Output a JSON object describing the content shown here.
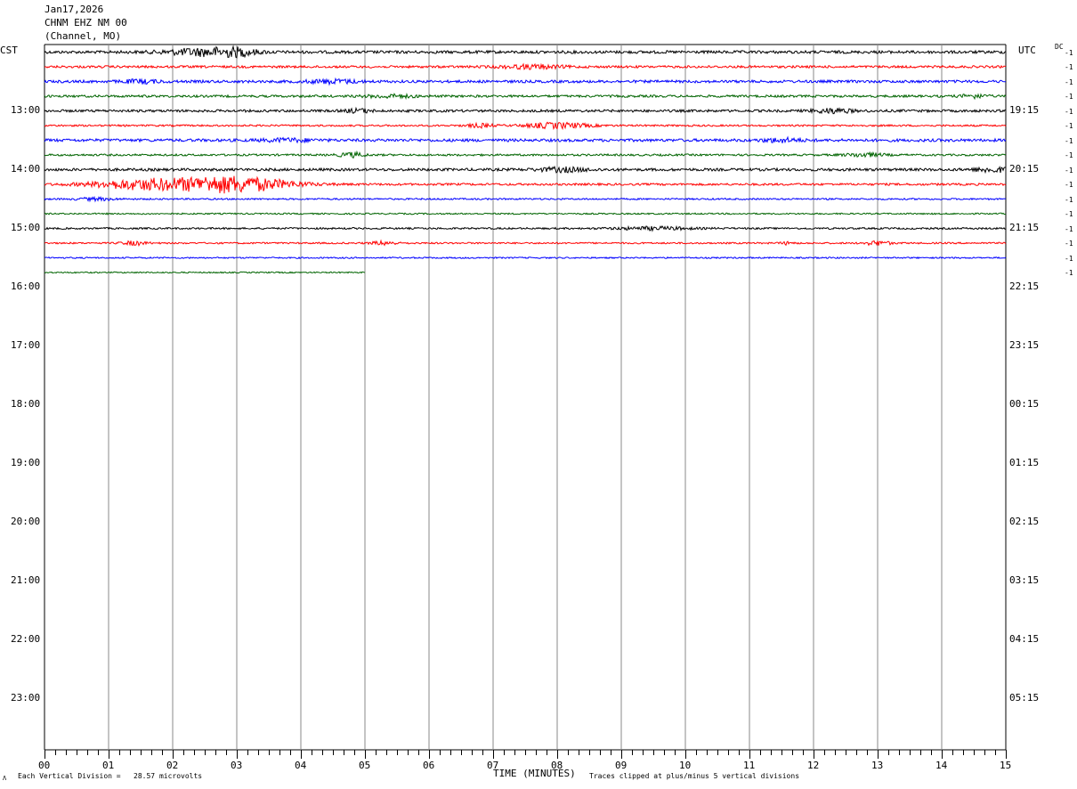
{
  "header": {
    "date": "Jan17,2026",
    "station": "CHNM EHZ NM 00",
    "location": "(Channel, MO)"
  },
  "axis": {
    "left_zone": "CST",
    "right_zone": "UTC",
    "dc_label": "DC",
    "xlabel": "TIME (MINUTES)"
  },
  "footer": {
    "division_note": "Each Vertical Division =   28.57 microvolts",
    "clip_note": "Traces clipped at plus/minus 5 vertical divisions",
    "logo_mark": "Λ"
  },
  "chart_data": {
    "type": "line",
    "title": "",
    "x_ticks": [
      "00",
      "01",
      "02",
      "03",
      "04",
      "05",
      "06",
      "07",
      "08",
      "09",
      "10",
      "11",
      "12",
      "13",
      "14",
      "15"
    ],
    "xlim": [
      0,
      15
    ],
    "rows_total": 48,
    "rows_per_hour": 4,
    "left_hour_labels": [
      "13:00",
      "14:00",
      "15:00",
      "16:00",
      "17:00",
      "18:00",
      "19:00",
      "20:00",
      "21:00",
      "22:00",
      "23:00"
    ],
    "right_hour_labels": [
      "19:15",
      "20:15",
      "21:15",
      "22:15",
      "23:15",
      "00:15",
      "01:15",
      "02:15",
      "03:15",
      "04:15",
      "05:15"
    ],
    "first_label_row": 4,
    "trace_colors": [
      "#000000",
      "#ff0000",
      "#0000ff",
      "#006400"
    ],
    "traces": [
      {
        "row": 0,
        "end_minute": 15,
        "noise": 1.6,
        "events": [
          {
            "t": 2.5,
            "amp": 4,
            "w": 0.6
          },
          {
            "t": 3.0,
            "amp": 3,
            "w": 0.3
          }
        ]
      },
      {
        "row": 1,
        "end_minute": 15,
        "noise": 1.3,
        "events": [
          {
            "t": 7.6,
            "amp": 2,
            "w": 0.5
          }
        ]
      },
      {
        "row": 2,
        "end_minute": 15,
        "noise": 1.5,
        "events": [
          {
            "t": 4.5,
            "amp": 2,
            "w": 0.4
          },
          {
            "t": 1.5,
            "amp": 1.8,
            "w": 0.3
          }
        ]
      },
      {
        "row": 3,
        "end_minute": 15,
        "noise": 1.3,
        "events": [
          {
            "t": 14.5,
            "amp": 2,
            "w": 0.2
          },
          {
            "t": 5.4,
            "amp": 1.6,
            "w": 0.4
          }
        ]
      },
      {
        "row": 4,
        "end_minute": 15,
        "noise": 1.4,
        "events": [
          {
            "t": 12.3,
            "amp": 2.5,
            "w": 0.3
          },
          {
            "t": 4.9,
            "amp": 2,
            "w": 0.2
          }
        ]
      },
      {
        "row": 5,
        "end_minute": 15,
        "noise": 1.0,
        "events": [
          {
            "t": 8.0,
            "amp": 3,
            "w": 0.5
          },
          {
            "t": 6.8,
            "amp": 2,
            "w": 0.2
          }
        ]
      },
      {
        "row": 6,
        "end_minute": 15,
        "noise": 1.6,
        "events": [
          {
            "t": 11.5,
            "amp": 2,
            "w": 0.3
          },
          {
            "t": 3.8,
            "amp": 1.6,
            "w": 0.4
          }
        ]
      },
      {
        "row": 7,
        "end_minute": 15,
        "noise": 1.1,
        "events": [
          {
            "t": 4.8,
            "amp": 2.5,
            "w": 0.2
          },
          {
            "t": 12.8,
            "amp": 2,
            "w": 0.3
          }
        ]
      },
      {
        "row": 8,
        "end_minute": 15,
        "noise": 1.5,
        "events": [
          {
            "t": 8.1,
            "amp": 2.2,
            "w": 0.4
          },
          {
            "t": 14.8,
            "amp": 2.5,
            "w": 0.3
          }
        ]
      },
      {
        "row": 9,
        "end_minute": 15,
        "noise": 1.2,
        "events": [
          {
            "t": 2.9,
            "amp": 9,
            "w": 0.9
          },
          {
            "t": 1.5,
            "amp": 5,
            "w": 0.8
          }
        ]
      },
      {
        "row": 10,
        "end_minute": 15,
        "noise": 0.9,
        "events": [
          {
            "t": 0.8,
            "amp": 1.5,
            "w": 0.3
          }
        ]
      },
      {
        "row": 11,
        "end_minute": 15,
        "noise": 0.8,
        "events": []
      },
      {
        "row": 12,
        "end_minute": 15,
        "noise": 1.0,
        "events": [
          {
            "t": 9.5,
            "amp": 1.6,
            "w": 0.6
          }
        ]
      },
      {
        "row": 13,
        "end_minute": 15,
        "noise": 0.9,
        "events": [
          {
            "t": 1.4,
            "amp": 2,
            "w": 0.2
          },
          {
            "t": 5.3,
            "amp": 2,
            "w": 0.2
          },
          {
            "t": 13.0,
            "amp": 2.4,
            "w": 0.2
          },
          {
            "t": 11.6,
            "amp": 1.6,
            "w": 0.1
          }
        ]
      },
      {
        "row": 14,
        "end_minute": 15,
        "noise": 0.8,
        "events": []
      },
      {
        "row": 15,
        "end_minute": 5,
        "noise": 0.7,
        "events": []
      }
    ]
  }
}
